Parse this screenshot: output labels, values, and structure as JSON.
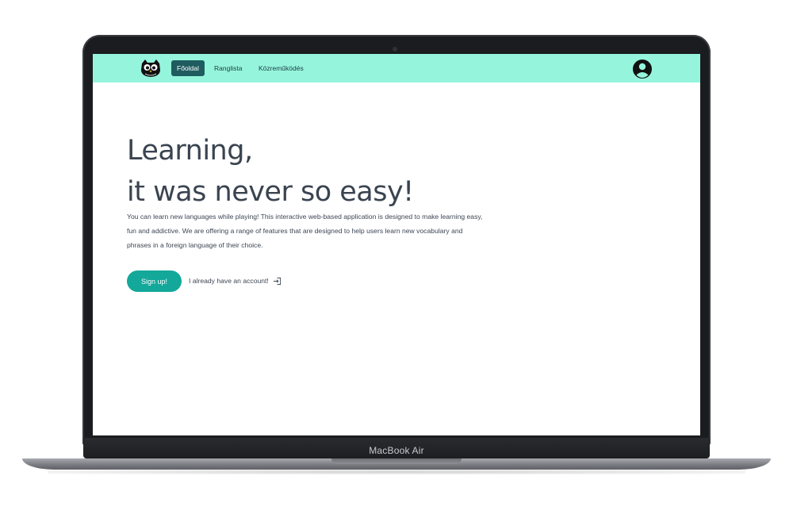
{
  "device": {
    "brand_label": "MacBook Air"
  },
  "navbar": {
    "background": "#95f5dc",
    "logo_icon": "owl-logo-icon",
    "items": [
      {
        "label": "Főoldal",
        "active": true
      },
      {
        "label": "Ranglista",
        "active": false
      },
      {
        "label": "Közreműködés",
        "active": false
      }
    ],
    "account_icon": "user-circle-icon"
  },
  "hero": {
    "title_line1": "Learning,",
    "title_line2": "it was never so easy!",
    "description": "You can learn new languages while playing! This interactive web-based application is designed to make learning easy, fun and addictive. We are offering a range of features that are designed to help users learn new vocabulary and phrases in a foreign language of their choice.",
    "signup_label": "Sign up!",
    "login_label": "I already have an account!",
    "login_icon": "sign-in-icon",
    "accent_color": "#13a89a"
  }
}
